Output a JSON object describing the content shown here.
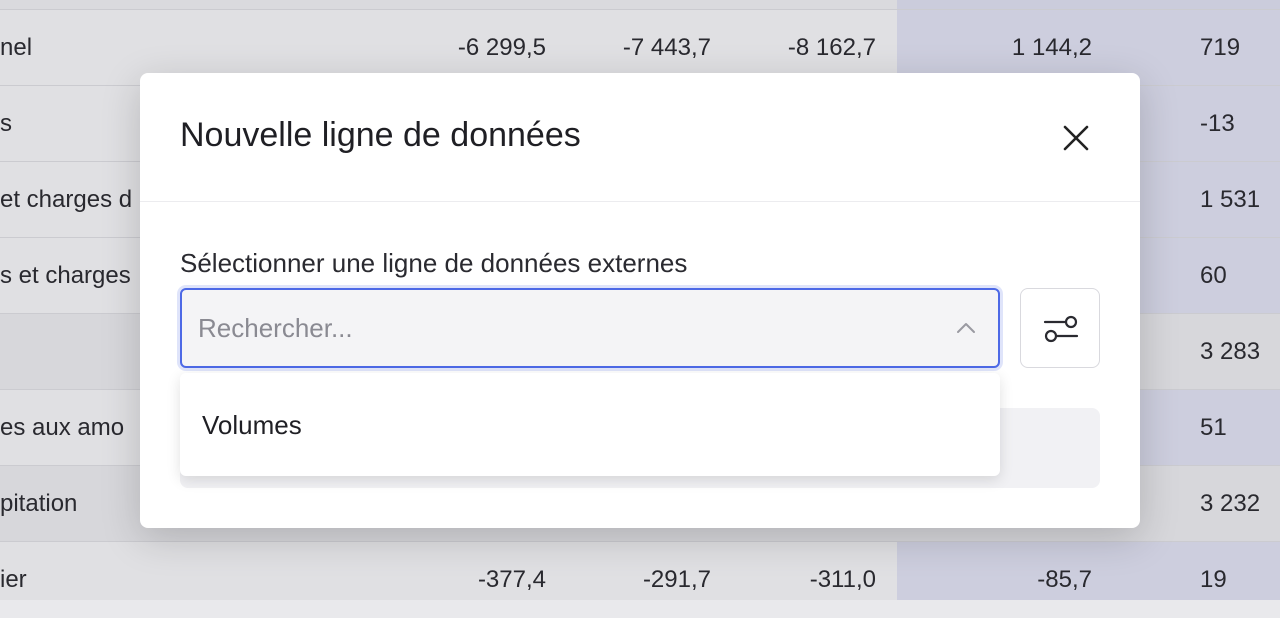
{
  "background_table": {
    "rows": [
      {
        "label": "nel",
        "values": [
          "-6 299,5",
          "-7 443,7",
          "-8 162,7",
          "1 144,2",
          "719"
        ]
      },
      {
        "label": "s",
        "values": [
          "",
          "",
          "",
          "",
          "-13"
        ]
      },
      {
        "label": "et charges d",
        "values": [
          "",
          "",
          "",
          "",
          "1 531"
        ]
      },
      {
        "label": "s et charges",
        "values": [
          "",
          "",
          "",
          "",
          "60"
        ]
      },
      {
        "label": "",
        "values": [
          "",
          "",
          "",
          "",
          "3 283"
        ]
      },
      {
        "label": "es aux amo",
        "values": [
          "",
          "",
          "",
          "",
          "51"
        ]
      },
      {
        "label": "pitation",
        "values": [
          "",
          "",
          "",
          "",
          "3 232"
        ]
      },
      {
        "label": "ier",
        "values": [
          "-377,4",
          "-291,7",
          "-311,0",
          "-85,7",
          "19"
        ]
      }
    ]
  },
  "modal": {
    "title": "Nouvelle ligne de données",
    "close_icon": "close-icon",
    "field_label": "Sélectionner une ligne de données externes",
    "search": {
      "value": "",
      "placeholder": "Rechercher..."
    },
    "filter_icon": "sliders-icon",
    "dropdown_options": [
      "Volumes"
    ]
  },
  "colors": {
    "accent": "#4d69e6",
    "highlight_column": "#d3d4e8",
    "modal_bg": "#ffffff"
  }
}
